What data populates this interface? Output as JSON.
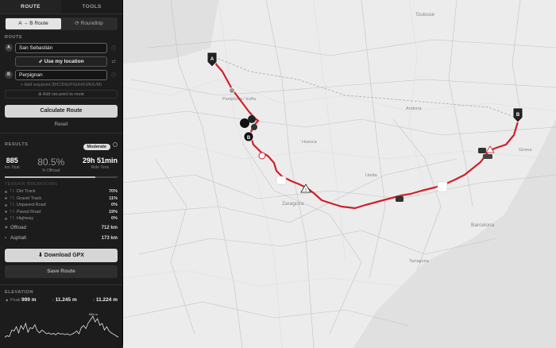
{
  "tabs": [
    "ROUTE",
    "TOOLS"
  ],
  "mode": {
    "ab": "A → B Route",
    "round": "⟳ Roundtrip"
  },
  "route": {
    "label": "ROUTE",
    "a_badge": "A",
    "b_badge": "B",
    "start": "San Sebastián",
    "my_location": "➶ Use my location",
    "end": "Perpignan",
    "add_waypoint": "+ Add waypoint (B/C/D/E/F/G/H/I/J/K/L/M)",
    "add_via": "⊕ Add via-point to route",
    "calculate": "Calculate Route",
    "reset": "Reset"
  },
  "results": {
    "label": "RESULTS",
    "difficulty": "Moderate",
    "distance": "885",
    "distance_label": "km Total",
    "offroad_pct": "80.5%",
    "offroad_label": "% Offroad",
    "ride_time": "29h 51min",
    "ride_time_label": "Ride Time",
    "offroad_fraction": 0.805
  },
  "terrain": {
    "label": "TERRAIN BREAKDOWN",
    "rows": [
      {
        "code": "T1",
        "name": "Dirt Track",
        "value": "70%"
      },
      {
        "code": "T5",
        "name": "Gravel Track",
        "value": "11%"
      },
      {
        "code": "T3",
        "name": "Unpaved Road",
        "value": "0%"
      },
      {
        "code": "T4",
        "name": "Paved Road",
        "value": "19%"
      },
      {
        "code": "T5",
        "name": "Highway",
        "value": "0%"
      }
    ],
    "offroad_label": "Offroad",
    "offroad_value": "712 km",
    "asphalt_label": "Asphalt",
    "asphalt_value": "173 km"
  },
  "actions": {
    "download": "⬇ Download GPX",
    "save": "Save Route"
  },
  "elevation": {
    "label": "ELEVATION",
    "peak_label": "▲ Peak",
    "peak": "999 m",
    "gain": "11.245 m",
    "loss": "11.224 m",
    "gain_icon": "↑",
    "loss_icon": "↓",
    "peak_marker": "999 m",
    "profile": [
      120,
      180,
      150,
      420,
      380,
      560,
      300,
      610,
      450,
      700,
      330,
      520,
      480,
      640,
      390,
      300,
      420,
      350,
      260,
      300,
      240,
      280,
      220,
      300,
      250,
      270,
      230,
      260,
      210,
      250,
      300,
      380,
      260,
      520,
      610,
      480,
      720,
      850,
      999,
      760,
      900,
      620,
      700,
      420,
      560,
      380,
      300,
      240,
      180,
      120
    ]
  },
  "map_labels": {
    "zaragoza": "Zaragoza",
    "barcelona": "Barcelona",
    "pamplona": "Pamplona / Iruña",
    "toulouse": "Toulouse",
    "andorra": "Andorra",
    "lleida": "Lleida",
    "girona": "Girona",
    "huesca": "Huesca",
    "tarragona": "Tarragona"
  },
  "colors": {
    "route": "#d0202a",
    "sidebar": "#1c1c1c",
    "map": "#ececec"
  }
}
